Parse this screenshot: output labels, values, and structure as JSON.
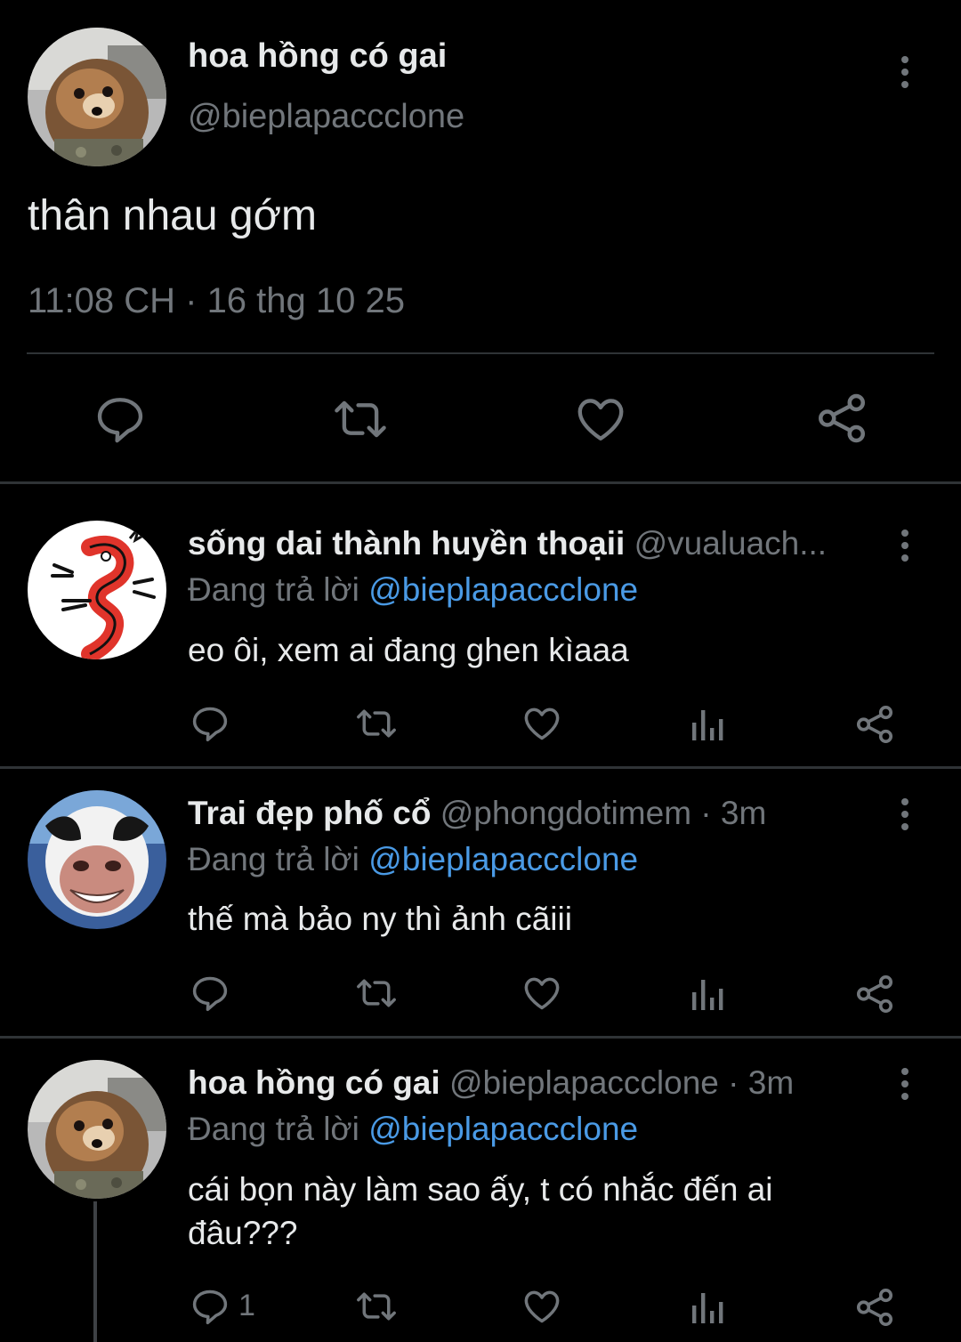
{
  "main_tweet": {
    "author_name": "hoa hồng có gai",
    "author_handle": "@bieplapaccclone",
    "text": "thân nhau gớm",
    "timestamp": "11:08 CH · 16 thg 10 25",
    "actions": [
      "reply-icon",
      "retweet-icon",
      "like-icon",
      "share-icon"
    ]
  },
  "replies": [
    {
      "author_name": "sống dai thành huyền thoạii",
      "author_handle": "@vualuach...",
      "time": "",
      "replying_prefix": "Đang trả lời",
      "replying_to": "@bieplapaccclone",
      "text": "eo ôi, xem ai đang ghen kìaaa",
      "reply_count": ""
    },
    {
      "author_name": "Trai đẹp phố cổ",
      "author_handle": "@phongdotimem",
      "time": " · 3m",
      "replying_prefix": "Đang trả lời",
      "replying_to": "@bieplapaccclone",
      "text": "thế mà bảo ny thì ảnh cãiii",
      "reply_count": ""
    },
    {
      "author_name": "hoa hồng có gai",
      "author_handle": "@bieplapaccclone",
      "time": " · 3m",
      "replying_prefix": "Đang trả lời",
      "replying_to": "@bieplapaccclone",
      "text": "cái bọn này làm sao ấy, t có nhắc đến ai đâu???",
      "reply_count": "1"
    }
  ],
  "colors": {
    "background": "#000000",
    "text_primary": "#e7e9ea",
    "text_secondary": "#71767b",
    "mention": "#4a9ae5",
    "divider": "#2f3336"
  }
}
